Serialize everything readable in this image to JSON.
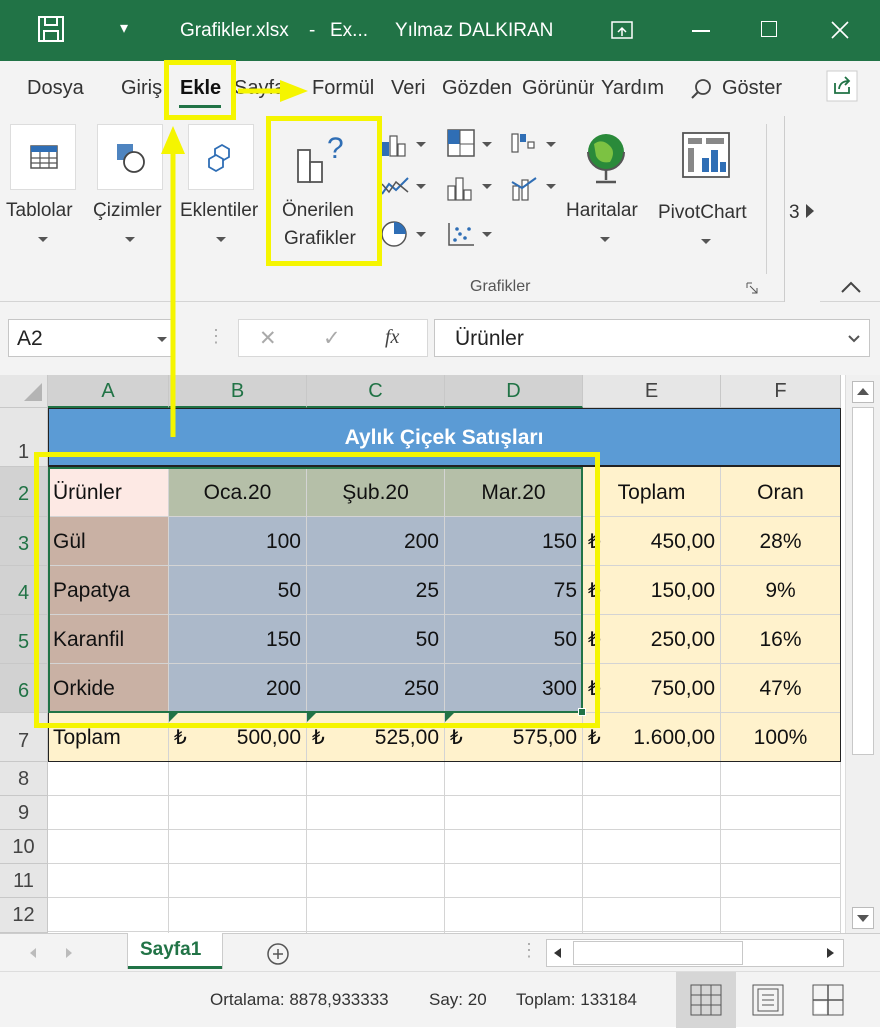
{
  "window": {
    "file": "Grafikler.xlsx",
    "app_short": "Ex...",
    "separator": "-",
    "user": "Yılmaz DALKIRAN",
    "qat_dropdown": "▾"
  },
  "tabs": [
    "Dosya",
    "Giriş",
    "Ekle",
    "Sayfa",
    "Formül",
    "Veri",
    "Gözden",
    "Görünüm",
    "Yardım"
  ],
  "tell_me": "Göster",
  "ribbon": {
    "tablolar": "Tablolar",
    "cizimler": "Çizimler",
    "eklentiler": "Eklentiler",
    "onerilen_line1": "Önerilen",
    "onerilen_line2": "Grafikler",
    "haritalar": "Haritalar",
    "pivotchart": "PivotChart",
    "more": "3",
    "group": "Grafikler"
  },
  "formula_bar": {
    "name_box": "A2",
    "fx": "fx",
    "value": "Ürünler",
    "cancel": "✕",
    "enter": "✓"
  },
  "columns": [
    "A",
    "B",
    "C",
    "D",
    "E",
    "F"
  ],
  "rows": [
    "1",
    "2",
    "3",
    "4",
    "5",
    "6",
    "7",
    "8",
    "9",
    "10",
    "11",
    "12"
  ],
  "table": {
    "title": "Aylık Çiçek Satışları",
    "headers": [
      "Ürünler",
      "Oca.20",
      "Şub.20",
      "Mar.20",
      "Toplam",
      "Oran"
    ],
    "data": [
      {
        "name": "Gül",
        "v": [
          "100",
          "200",
          "150"
        ],
        "total": "450,00",
        "ratio": "28%"
      },
      {
        "name": "Papatya",
        "v": [
          "50",
          "25",
          "75"
        ],
        "total": "150,00",
        "ratio": "9%"
      },
      {
        "name": "Karanfil",
        "v": [
          "150",
          "50",
          "50"
        ],
        "total": "250,00",
        "ratio": "16%"
      },
      {
        "name": "Orkide",
        "v": [
          "200",
          "250",
          "300"
        ],
        "total": "750,00",
        "ratio": "47%"
      }
    ],
    "total_row": {
      "label": "Toplam",
      "v": [
        "500,00",
        "525,00",
        "575,00"
      ],
      "total": "1.600,00",
      "ratio": "100%"
    },
    "currency": "₺"
  },
  "sheet_tab": "Sayfa1",
  "status": {
    "average": "Ortalama: 8878,933333",
    "count": "Say: 20",
    "sum": "Toplam: 133184"
  },
  "colors": {
    "accent": "#217346",
    "highlight": "#f5f500",
    "title_fill": "#5b9bd5",
    "header_fill": "#fff2cc",
    "data_fill": "#acb9ca",
    "name_fill": "#c9b1a4"
  }
}
